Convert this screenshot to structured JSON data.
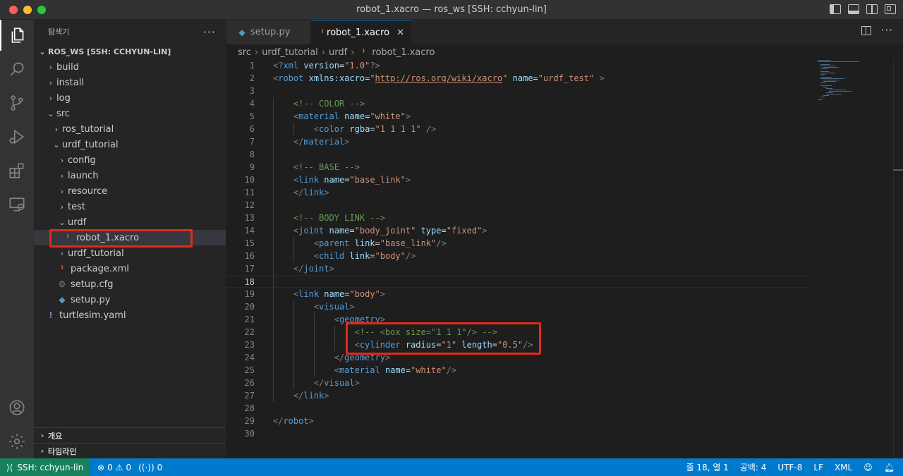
{
  "window": {
    "title": "robot_1.xacro — ros_ws [SSH: cchyun-lin]"
  },
  "activity_bar": [
    "explorer-icon",
    "search-icon",
    "source-control-icon",
    "run-debug-icon",
    "extensions-icon",
    "remote-explorer-icon",
    "account-icon",
    "settings-gear-icon"
  ],
  "sidebar": {
    "title": "탐색기",
    "more": "···",
    "root_label": "ROS_WS [SSH: CCHYUN-LIN]",
    "items": [
      {
        "label": "build",
        "chev": "›",
        "icon": ""
      },
      {
        "label": "install",
        "chev": "›",
        "icon": ""
      },
      {
        "label": "log",
        "chev": "›",
        "icon": ""
      },
      {
        "label": "src",
        "chev": "⌄",
        "icon": ""
      },
      {
        "label": "ros_tutorial",
        "chev": "›",
        "icon": ""
      },
      {
        "label": "urdf_tutorial",
        "chev": "⌄",
        "icon": ""
      },
      {
        "label": "config",
        "chev": "›",
        "icon": ""
      },
      {
        "label": "launch",
        "chev": "›",
        "icon": ""
      },
      {
        "label": "resource",
        "chev": "›",
        "icon": ""
      },
      {
        "label": "test",
        "chev": "›",
        "icon": ""
      },
      {
        "label": "urdf",
        "chev": "⌄",
        "icon": ""
      },
      {
        "label": "robot_1.xacro",
        "chev": "",
        "icon": "⁾"
      },
      {
        "label": "urdf_tutorial",
        "chev": "›",
        "icon": ""
      },
      {
        "label": "package.xml",
        "chev": "",
        "icon": "⁾"
      },
      {
        "label": "setup.cfg",
        "chev": "",
        "icon": "⚙"
      },
      {
        "label": "setup.py",
        "chev": "",
        "icon": "◆"
      },
      {
        "label": "turtlesim.yaml",
        "chev": "",
        "icon": "!"
      }
    ],
    "outline_label": "개요",
    "timeline_label": "타임라인"
  },
  "tabs": [
    {
      "label": "setup.py",
      "icon": "◆"
    },
    {
      "label": "robot_1.xacro",
      "icon": "⁾",
      "close": "✕"
    }
  ],
  "breadcrumbs": [
    "src",
    "urdf_tutorial",
    "urdf",
    "robot_1.xacro"
  ],
  "breadcrumb_sep": "›",
  "editor": {
    "line_numbers": [
      "1",
      "2",
      "3",
      "4",
      "5",
      "6",
      "7",
      "8",
      "9",
      "10",
      "11",
      "12",
      "13",
      "14",
      "15",
      "16",
      "17",
      "18",
      "19",
      "20",
      "21",
      "22",
      "23",
      "24",
      "25",
      "26",
      "27",
      "28",
      "29",
      "30"
    ],
    "lines": [
      [
        [
          "pun",
          "<?"
        ],
        [
          "tag",
          "xml"
        ],
        [
          "txt",
          " "
        ],
        [
          "attr",
          "version"
        ],
        [
          "txt",
          "="
        ],
        [
          "str",
          "\"1.0\""
        ],
        [
          "pun",
          "?>"
        ]
      ],
      [
        [
          "pun",
          "<"
        ],
        [
          "tag",
          "robot"
        ],
        [
          "txt",
          " "
        ],
        [
          "attr",
          "xmlns:xacro"
        ],
        [
          "txt",
          "="
        ],
        [
          "str",
          "\""
        ],
        [
          "url",
          "http://ros.org/wiki/xacro"
        ],
        [
          "str",
          "\""
        ],
        [
          "txt",
          " "
        ],
        [
          "attr",
          "name"
        ],
        [
          "txt",
          "="
        ],
        [
          "str",
          "\"urdf_test\""
        ],
        [
          "txt",
          " "
        ],
        [
          "pun",
          ">"
        ]
      ],
      [],
      [
        [
          "txt",
          "    "
        ],
        [
          "com",
          "<!-- COLOR -->"
        ]
      ],
      [
        [
          "txt",
          "    "
        ],
        [
          "pun",
          "<"
        ],
        [
          "tag",
          "material"
        ],
        [
          "txt",
          " "
        ],
        [
          "attr",
          "name"
        ],
        [
          "txt",
          "="
        ],
        [
          "str",
          "\"white\""
        ],
        [
          "pun",
          ">"
        ]
      ],
      [
        [
          "txt",
          "        "
        ],
        [
          "pun",
          "<"
        ],
        [
          "tag",
          "color"
        ],
        [
          "txt",
          " "
        ],
        [
          "attr",
          "rgba"
        ],
        [
          "txt",
          "="
        ],
        [
          "str",
          "\"1 1 1 1\""
        ],
        [
          "txt",
          " "
        ],
        [
          "pun",
          "/>"
        ]
      ],
      [
        [
          "txt",
          "    "
        ],
        [
          "pun",
          "</"
        ],
        [
          "tag",
          "material"
        ],
        [
          "pun",
          ">"
        ]
      ],
      [],
      [
        [
          "txt",
          "    "
        ],
        [
          "com",
          "<!-- BASE -->"
        ]
      ],
      [
        [
          "txt",
          "    "
        ],
        [
          "pun",
          "<"
        ],
        [
          "tag",
          "link"
        ],
        [
          "txt",
          " "
        ],
        [
          "attr",
          "name"
        ],
        [
          "txt",
          "="
        ],
        [
          "str",
          "\"base_link\""
        ],
        [
          "pun",
          ">"
        ]
      ],
      [
        [
          "txt",
          "    "
        ],
        [
          "pun",
          "</"
        ],
        [
          "tag",
          "link"
        ],
        [
          "pun",
          ">"
        ]
      ],
      [],
      [
        [
          "txt",
          "    "
        ],
        [
          "com",
          "<!-- BODY LINK -->"
        ]
      ],
      [
        [
          "txt",
          "    "
        ],
        [
          "pun",
          "<"
        ],
        [
          "tag",
          "joint"
        ],
        [
          "txt",
          " "
        ],
        [
          "attr",
          "name"
        ],
        [
          "txt",
          "="
        ],
        [
          "str",
          "\"body_joint\""
        ],
        [
          "txt",
          " "
        ],
        [
          "attr",
          "type"
        ],
        [
          "txt",
          "="
        ],
        [
          "str",
          "\"fixed\""
        ],
        [
          "pun",
          ">"
        ]
      ],
      [
        [
          "txt",
          "        "
        ],
        [
          "pun",
          "<"
        ],
        [
          "tag",
          "parent"
        ],
        [
          "txt",
          " "
        ],
        [
          "attr",
          "link"
        ],
        [
          "txt",
          "="
        ],
        [
          "str",
          "\"base_link\""
        ],
        [
          "pun",
          "/>"
        ]
      ],
      [
        [
          "txt",
          "        "
        ],
        [
          "pun",
          "<"
        ],
        [
          "tag",
          "child"
        ],
        [
          "txt",
          " "
        ],
        [
          "attr",
          "link"
        ],
        [
          "txt",
          "="
        ],
        [
          "str",
          "\"body\""
        ],
        [
          "pun",
          "/>"
        ]
      ],
      [
        [
          "txt",
          "    "
        ],
        [
          "pun",
          "</"
        ],
        [
          "tag",
          "joint"
        ],
        [
          "pun",
          ">"
        ]
      ],
      [],
      [
        [
          "txt",
          "    "
        ],
        [
          "pun",
          "<"
        ],
        [
          "tag",
          "link"
        ],
        [
          "txt",
          " "
        ],
        [
          "attr",
          "name"
        ],
        [
          "txt",
          "="
        ],
        [
          "str",
          "\"body\""
        ],
        [
          "pun",
          ">"
        ]
      ],
      [
        [
          "txt",
          "        "
        ],
        [
          "pun",
          "<"
        ],
        [
          "tag",
          "visual"
        ],
        [
          "pun",
          ">"
        ]
      ],
      [
        [
          "txt",
          "            "
        ],
        [
          "pun",
          "<"
        ],
        [
          "tag",
          "geometry"
        ],
        [
          "pun",
          ">"
        ]
      ],
      [
        [
          "txt",
          "                "
        ],
        [
          "com",
          "<!-- <box size=\"1 1 1\"/> -->"
        ]
      ],
      [
        [
          "txt",
          "                "
        ],
        [
          "pun",
          "<"
        ],
        [
          "tag",
          "cylinder"
        ],
        [
          "txt",
          " "
        ],
        [
          "attr",
          "radius"
        ],
        [
          "txt",
          "="
        ],
        [
          "str",
          "\"1\""
        ],
        [
          "txt",
          " "
        ],
        [
          "attr",
          "length"
        ],
        [
          "txt",
          "="
        ],
        [
          "str",
          "\"0.5\""
        ],
        [
          "pun",
          "/>"
        ]
      ],
      [
        [
          "txt",
          "            "
        ],
        [
          "pun",
          "</"
        ],
        [
          "tag",
          "geometry"
        ],
        [
          "pun",
          ">"
        ]
      ],
      [
        [
          "txt",
          "            "
        ],
        [
          "pun",
          "<"
        ],
        [
          "tag",
          "material"
        ],
        [
          "txt",
          " "
        ],
        [
          "attr",
          "name"
        ],
        [
          "txt",
          "="
        ],
        [
          "str",
          "\"white\""
        ],
        [
          "pun",
          "/>"
        ]
      ],
      [
        [
          "txt",
          "        "
        ],
        [
          "pun",
          "</"
        ],
        [
          "tag",
          "visual"
        ],
        [
          "pun",
          ">"
        ]
      ],
      [
        [
          "txt",
          "    "
        ],
        [
          "pun",
          "</"
        ],
        [
          "tag",
          "link"
        ],
        [
          "pun",
          ">"
        ]
      ],
      [],
      [
        [
          "pun",
          "</"
        ],
        [
          "tag",
          "robot"
        ],
        [
          "pun",
          ">"
        ]
      ],
      []
    ],
    "current_line": 18
  },
  "statusbar": {
    "remote": "SSH: cchyun-lin",
    "errors": "0",
    "warnings": "0",
    "ports": "0",
    "position": "줄 18, 열 1",
    "indent": "공백: 4",
    "encoding": "UTF-8",
    "eol": "LF",
    "language": "XML"
  },
  "colors": {
    "accent": "#007acc",
    "remote_bg": "#16825d",
    "highlight_box": "#e02a1b"
  }
}
